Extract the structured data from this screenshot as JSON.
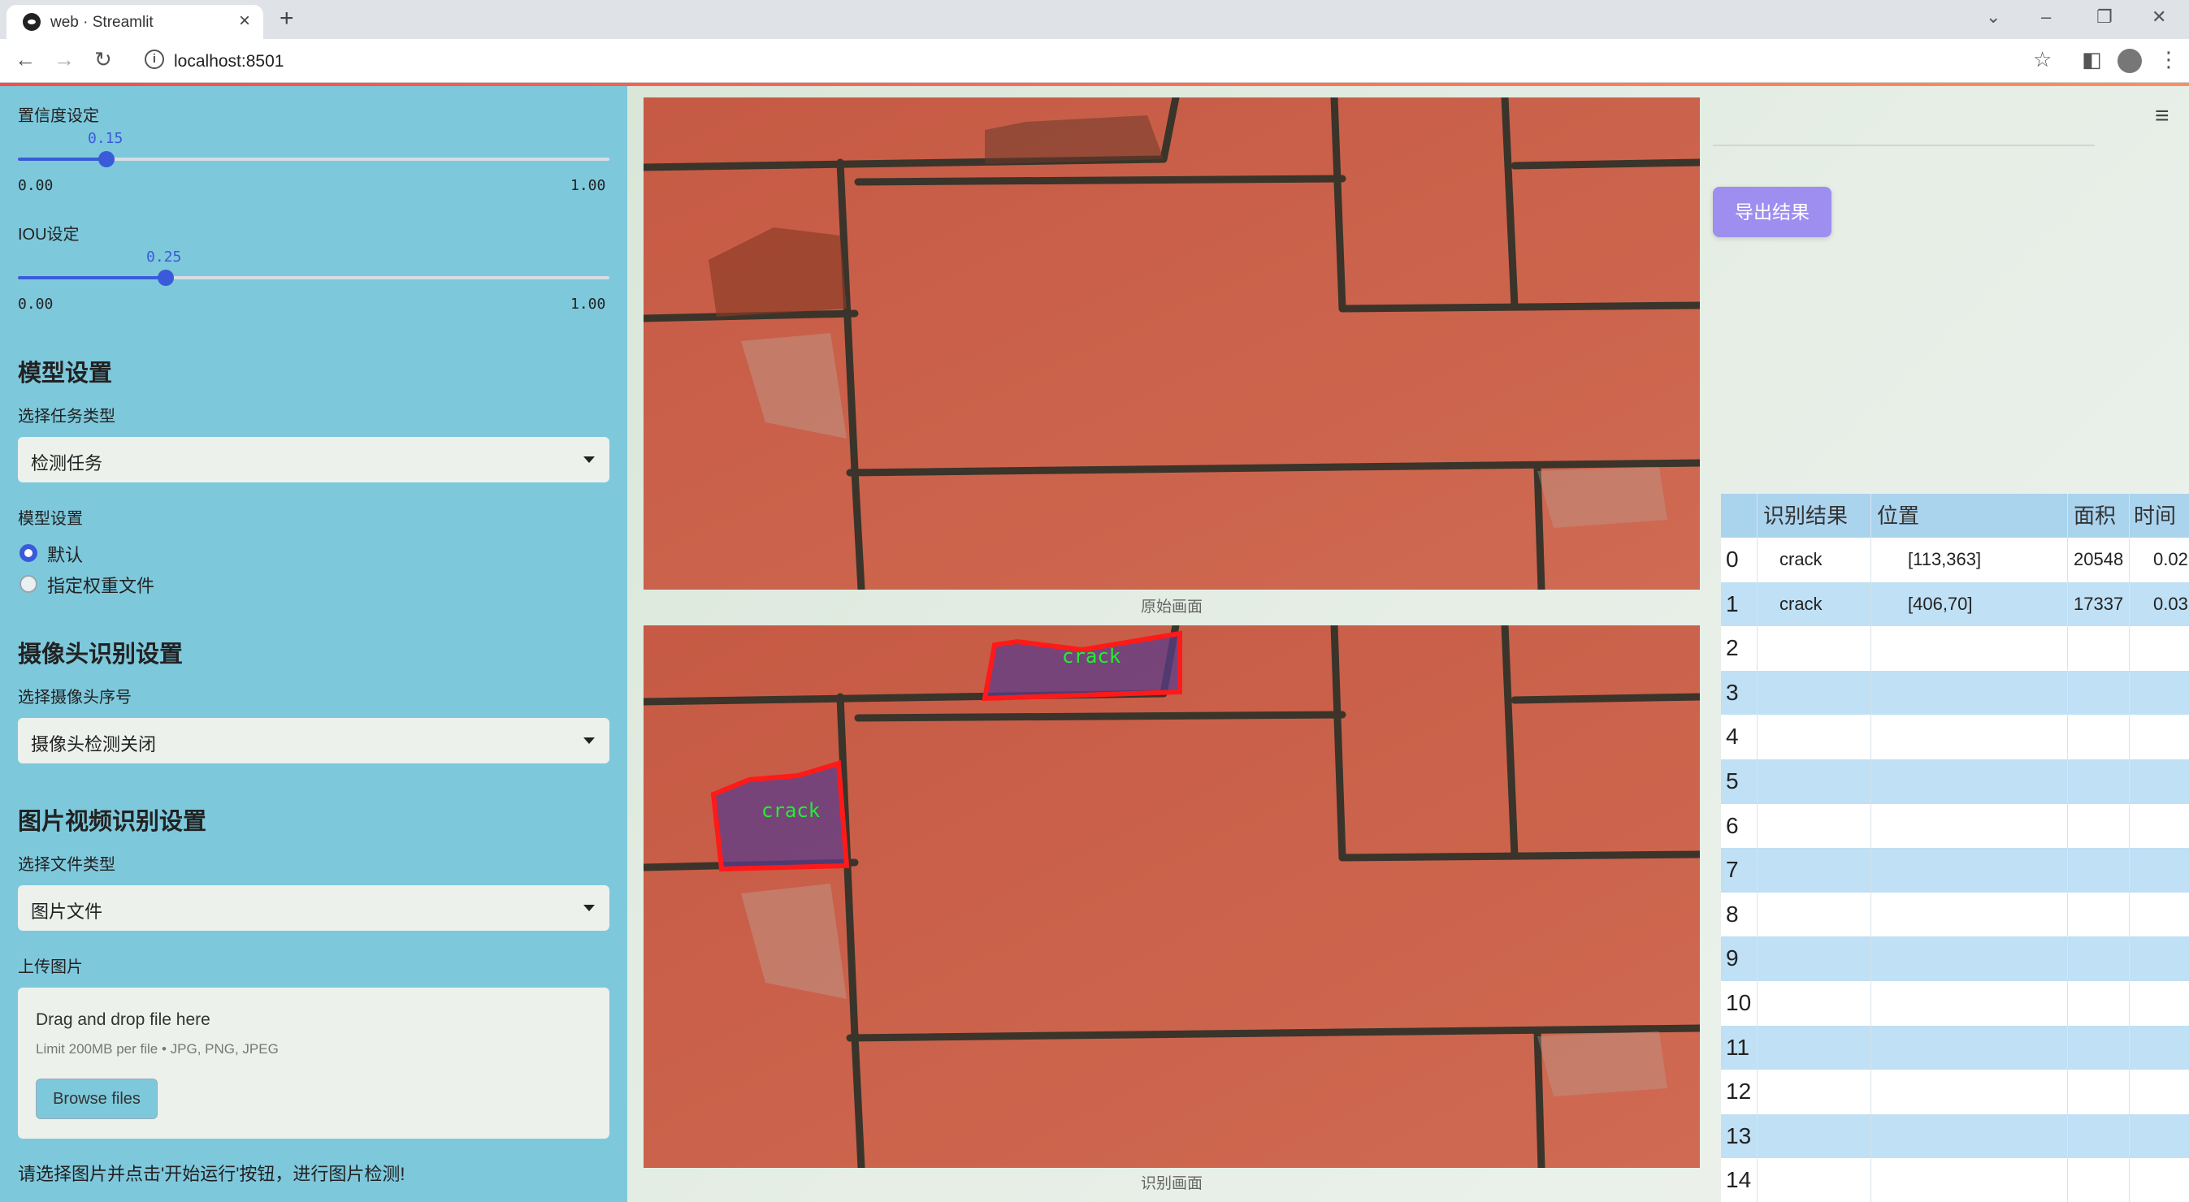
{
  "browser": {
    "tab_title": "web · Streamlit",
    "url": "localhost:8501"
  },
  "sidebar": {
    "confidence": {
      "label": "置信度设定",
      "value": "0.15",
      "value_num": 0.15,
      "min": "0.00",
      "max": "1.00"
    },
    "iou": {
      "label": "IOU设定",
      "value": "0.25",
      "value_num": 0.25,
      "min": "0.00",
      "max": "1.00"
    },
    "model_section": "模型设置",
    "task_label": "选择任务类型",
    "task_value": "检测任务",
    "model_label": "模型设置",
    "model_options": [
      "默认",
      "指定权重文件"
    ],
    "camera_section": "摄像头识别设置",
    "camera_label": "选择摄像头序号",
    "camera_value": "摄像头检测关闭",
    "media_section": "图片视频识别设置",
    "filetype_label": "选择文件类型",
    "filetype_value": "图片文件",
    "upload_label": "上传图片",
    "upload_drag": "Drag and drop file here",
    "upload_limit": "Limit 200MB per file • JPG, PNG, JPEG",
    "browse_label": "Browse files",
    "hint": "请选择图片并点击'开始运行'按钮，进行图片检测!"
  },
  "main": {
    "original_caption": "原始画面",
    "result_caption": "识别画面",
    "detection_label": "crack",
    "export_label": "导出结果"
  },
  "results_table": {
    "columns": [
      "识别结果",
      "位置",
      "面积",
      "时间"
    ],
    "rows": [
      {
        "index": "0",
        "result": "crack",
        "position": "[113,363]",
        "area": "20548",
        "time": "0.02"
      },
      {
        "index": "1",
        "result": "crack",
        "position": "[406,70]",
        "area": "17337",
        "time": "0.03"
      },
      {
        "index": "2"
      },
      {
        "index": "3"
      },
      {
        "index": "4"
      },
      {
        "index": "5"
      },
      {
        "index": "6"
      },
      {
        "index": "7"
      },
      {
        "index": "8"
      },
      {
        "index": "9"
      },
      {
        "index": "10"
      },
      {
        "index": "11"
      },
      {
        "index": "12"
      },
      {
        "index": "13"
      },
      {
        "index": "14"
      }
    ]
  },
  "colors": {
    "sidebar_bg": "#7ec8dc",
    "accent": "#3a5bd9",
    "export_button": "#9d8ef0",
    "brick": "#c9604a",
    "mortar": "#3a3a2e",
    "detection_outline": "#ff1a1a",
    "detection_fill": "#5b3c8a",
    "detection_text": "#22ee33"
  }
}
